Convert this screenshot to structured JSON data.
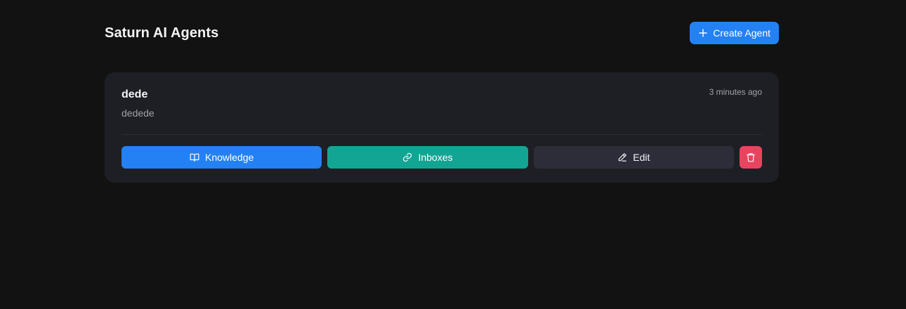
{
  "header": {
    "title": "Saturn AI Agents",
    "create_button": {
      "label": "Create Agent",
      "icon": "plus-icon"
    }
  },
  "agents": [
    {
      "name": "dede",
      "description": "dedede",
      "updated": "3 minutes ago",
      "actions": {
        "knowledge": {
          "label": "Knowledge",
          "icon": "book-open-icon"
        },
        "inboxes": {
          "label": "Inboxes",
          "icon": "link-icon"
        },
        "edit": {
          "label": "Edit",
          "icon": "pencil-icon"
        },
        "delete": {
          "icon": "trash-icon"
        }
      }
    }
  ],
  "colors": {
    "background": "#121212",
    "card": "#1e1f25",
    "primary": "#2481f3",
    "teal": "#13a594",
    "secondary": "#2c2d38",
    "danger": "#e9445f"
  }
}
